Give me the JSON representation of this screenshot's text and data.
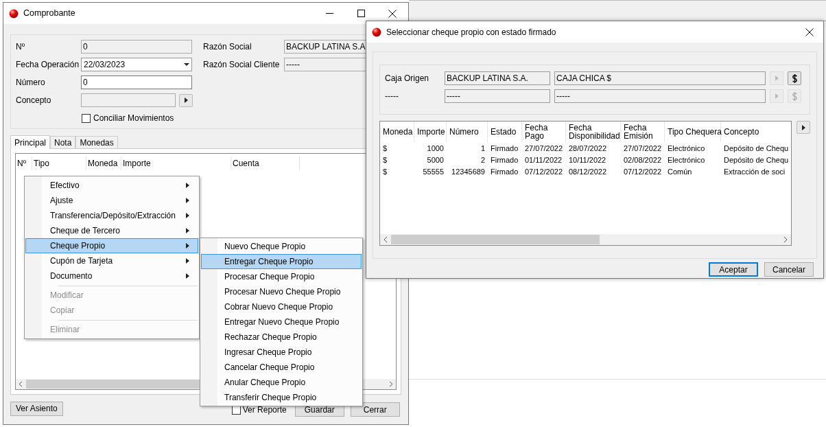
{
  "main_window": {
    "title": "Comprobante",
    "fields": [
      {
        "label": "Nº",
        "value": "0",
        "kind": "readonly"
      },
      {
        "label": "Fecha Operación",
        "value": "22/03/2023",
        "kind": "date"
      },
      {
        "label": "Número",
        "value": "0",
        "kind": "input"
      },
      {
        "label": "Concepto",
        "kind": "lookup"
      }
    ],
    "reconcile_checkbox": {
      "label": "Conciliar Movimientos",
      "checked": false
    },
    "right_fields": [
      {
        "label": "Razón Social",
        "value": "BACKUP LATINA S.A."
      },
      {
        "label": "Razón Social Cliente",
        "value": "-----"
      }
    ],
    "tabs": [
      {
        "label": "Principal",
        "selected": true
      },
      {
        "label": "Nota",
        "selected": false
      },
      {
        "label": "Monedas",
        "selected": false
      }
    ],
    "grid_columns": [
      "Nº",
      "Tipo",
      "Moneda",
      "Importe",
      "Cuenta"
    ],
    "view_entry_button": "Ver Asiento",
    "report_checkbox": {
      "label": "Ver Reporte",
      "checked": false
    },
    "buttons": [
      "Guardar",
      "Cerrar"
    ]
  },
  "context_menu": {
    "items": [
      {
        "kind": "submenu",
        "label": "Efectivo",
        "selected": false,
        "disabled": false
      },
      {
        "kind": "submenu",
        "label": "Ajuste",
        "selected": false,
        "disabled": false
      },
      {
        "kind": "submenu",
        "label": "Transferencia/Depósito/Extracción",
        "selected": false,
        "disabled": false
      },
      {
        "kind": "submenu",
        "label": "Cheque de Tercero",
        "selected": false,
        "disabled": false
      },
      {
        "kind": "submenu",
        "label": "Cheque Propio",
        "selected": true,
        "disabled": false
      },
      {
        "kind": "submenu",
        "label": "Cupón de Tarjeta",
        "selected": false,
        "disabled": false
      },
      {
        "kind": "submenu",
        "label": "Documento",
        "selected": false,
        "disabled": false
      },
      {
        "kind": "separator"
      },
      {
        "kind": "item",
        "label": "Modificar",
        "selected": false,
        "disabled": true
      },
      {
        "kind": "item",
        "label": "Copiar",
        "selected": false,
        "disabled": true
      },
      {
        "kind": "separator"
      },
      {
        "kind": "item",
        "label": "Eliminar",
        "selected": false,
        "disabled": true
      }
    ]
  },
  "submenu": {
    "items": [
      {
        "label": "Nuevo Cheque Propio",
        "selected": false
      },
      {
        "label": "Entregar Cheque Propio",
        "selected": true
      },
      {
        "label": "Procesar Cheque Propio",
        "selected": false
      },
      {
        "label": "Procesar Nuevo Cheque Propio",
        "selected": false
      },
      {
        "label": "Cobrar Nuevo Cheque Propio",
        "selected": false
      },
      {
        "label": "Entregar Nuevo Cheque Propio",
        "selected": false
      },
      {
        "label": "Rechazar Cheque Propio",
        "selected": false
      },
      {
        "label": "Ingresar Cheque Propio",
        "selected": false
      },
      {
        "label": "Cancelar Cheque Propio",
        "selected": false
      },
      {
        "label": "Anular Cheque Propio",
        "selected": false
      },
      {
        "label": "Transferir Cheque Propio",
        "selected": false
      }
    ]
  },
  "dialog": {
    "title": "Seleccionar cheque propio con estado firmado",
    "source_rows": [
      {
        "label": "Caja Origen",
        "value_1": "BACKUP LATINA S.A.",
        "value_2": "CAJA CHICA $",
        "disabled": false
      },
      {
        "label": "-----",
        "value_1": "-----",
        "value_2": "-----",
        "disabled": true
      }
    ],
    "columns": [
      "Moneda",
      "Importe",
      "Número",
      "Estado",
      "Fecha Pago",
      "Fecha Disponibilidad",
      "Fecha Emisión",
      "Tipo Chequera",
      "Concepto"
    ],
    "rows": [
      [
        "$",
        "1000",
        "1",
        "Firmado",
        "27/07/2022",
        "28/07/2022",
        "27/07/2022",
        "Electrónico",
        "Depósito de Chequ"
      ],
      [
        "$",
        "5000",
        "2",
        "Firmado",
        "01/11/2022",
        "10/11/2022",
        "02/08/2022",
        "Electrónico",
        "Depósito de Chequ"
      ],
      [
        "$",
        "55555",
        "12345689",
        "Firmado",
        "07/12/2022",
        "08/12/2022",
        "07/12/2022",
        "Común",
        "Extracción de soci"
      ]
    ],
    "buttons": [
      {
        "label": "Aceptar",
        "default": true
      },
      {
        "label": "Cancelar",
        "default": false
      }
    ]
  }
}
